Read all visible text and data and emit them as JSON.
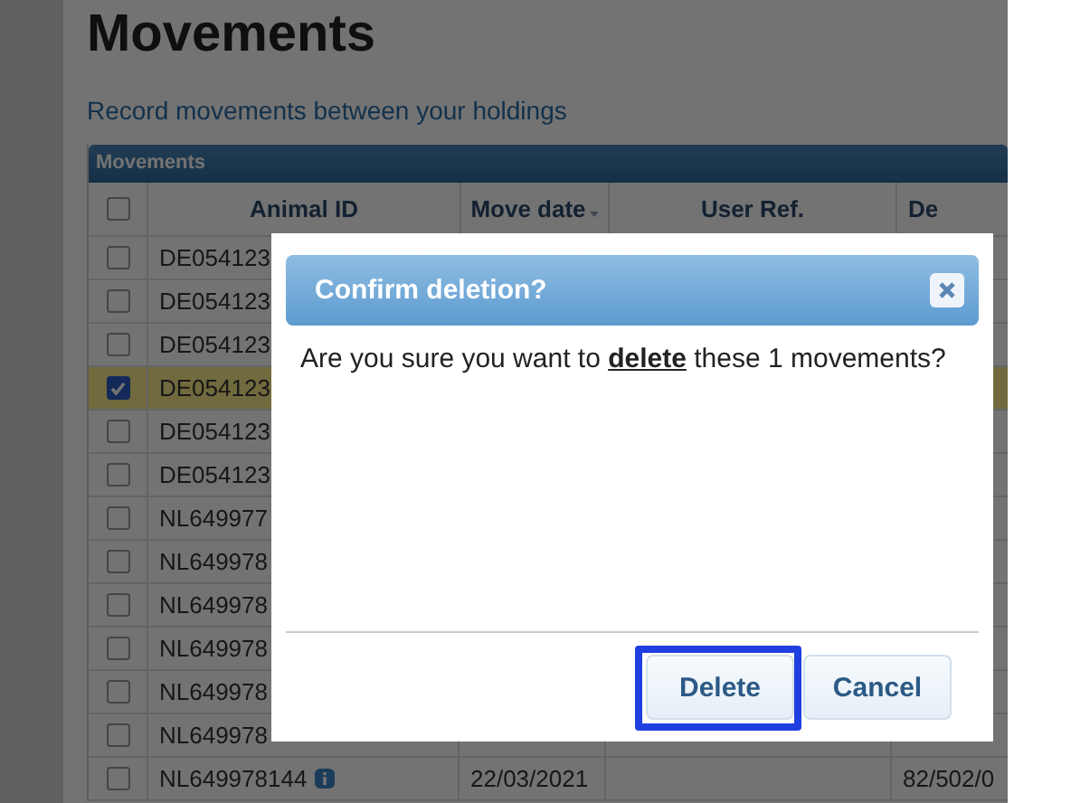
{
  "page": {
    "title": "Movements",
    "subtitle": "Record movements between your holdings"
  },
  "table": {
    "panel_title": "Movements",
    "all_selected": false,
    "columns": [
      {
        "label": "Animal ID",
        "sorted": false
      },
      {
        "label": "Move date",
        "sorted": true
      },
      {
        "label": "User Ref.",
        "sorted": false
      },
      {
        "label": "De",
        "sorted": false
      }
    ],
    "rows": [
      {
        "selected": false,
        "animal_id": "DE054123",
        "move_date": "",
        "user_ref": "",
        "column_4": ""
      },
      {
        "selected": false,
        "animal_id": "DE054123",
        "move_date": "",
        "user_ref": "",
        "column_4": ""
      },
      {
        "selected": false,
        "animal_id": "DE054123",
        "move_date": "",
        "user_ref": "",
        "column_4": ""
      },
      {
        "selected": true,
        "animal_id": "DE054123",
        "move_date": "",
        "user_ref": "",
        "column_4": ""
      },
      {
        "selected": false,
        "animal_id": "DE054123",
        "move_date": "",
        "user_ref": "",
        "column_4": ""
      },
      {
        "selected": false,
        "animal_id": "DE054123",
        "move_date": "",
        "user_ref": "",
        "column_4": ""
      },
      {
        "selected": false,
        "animal_id": "NL649977",
        "move_date": "",
        "user_ref": "",
        "column_4": ""
      },
      {
        "selected": false,
        "animal_id": "NL649978",
        "move_date": "",
        "user_ref": "",
        "column_4": ""
      },
      {
        "selected": false,
        "animal_id": "NL649978",
        "move_date": "",
        "user_ref": "",
        "column_4": ""
      },
      {
        "selected": false,
        "animal_id": "NL649978",
        "move_date": "",
        "user_ref": "",
        "column_4": ""
      },
      {
        "selected": false,
        "animal_id": "NL649978",
        "move_date": "",
        "user_ref": "",
        "column_4": ""
      },
      {
        "selected": false,
        "animal_id": "NL649978",
        "move_date": "",
        "user_ref": "",
        "column_4": ""
      },
      {
        "selected": false,
        "animal_id": "NL649978144",
        "info": true,
        "move_date": "22/03/2021",
        "user_ref": "",
        "column_4": "82/502/0"
      }
    ]
  },
  "dialog": {
    "title": "Confirm deletion?",
    "message": "Are you sure you want to **delete** these 1 movements?",
    "buttons": [
      {
        "label": "Delete",
        "highlighted": true
      },
      {
        "label": "Cancel",
        "highlighted": false
      }
    ]
  }
}
